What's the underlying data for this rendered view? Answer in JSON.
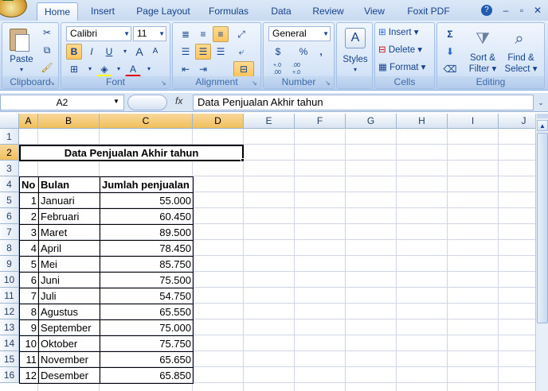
{
  "tabs": [
    "Home",
    "Insert",
    "Page Layout",
    "Formulas",
    "Data",
    "Review",
    "View",
    "Foxit PDF"
  ],
  "ribbon": {
    "clipboard": {
      "title": "Clipboard",
      "paste": "Paste"
    },
    "font": {
      "title": "Font",
      "name": "Calibri",
      "size": "11",
      "bold": "B",
      "italic": "I",
      "underline": "U",
      "grow": "A",
      "shrink": "A",
      "font_color": "A"
    },
    "alignment": {
      "title": "Alignment"
    },
    "number": {
      "title": "Number",
      "format": "General",
      "currency": "$",
      "percent": "%",
      "comma": ",",
      "inc": "+.0 .00",
      "dec": ".00 +.0"
    },
    "styles": {
      "title": "Styles",
      "label": "Styles"
    },
    "cells": {
      "title": "Cells",
      "insert": "Insert",
      "delete": "Delete",
      "format": "Format"
    },
    "editing": {
      "title": "Editing",
      "sigma": "Σ",
      "sort": "Sort &",
      "sort2": "Filter",
      "find": "Find &",
      "find2": "Select"
    }
  },
  "namebox": "A2",
  "fx": "fx",
  "formula": "Data Penjualan Akhir tahun",
  "columns": [
    "A",
    "B",
    "C",
    "D",
    "E",
    "F",
    "G",
    "H",
    "I",
    "J"
  ],
  "rows": [
    "1",
    "2",
    "3",
    "4",
    "5",
    "6",
    "7",
    "8",
    "9",
    "10",
    "11",
    "12",
    "13",
    "14",
    "15",
    "16"
  ],
  "sheet": {
    "title": "Data Penjualan Akhir tahun",
    "headers": {
      "no": "No",
      "bulan": "Bulan",
      "jumlah": "Jumlah penjualan"
    },
    "data": [
      {
        "no": "1",
        "bulan": "Januari",
        "jumlah": "55.000"
      },
      {
        "no": "2",
        "bulan": "Februari",
        "jumlah": "60.450"
      },
      {
        "no": "3",
        "bulan": "Maret",
        "jumlah": "89.500"
      },
      {
        "no": "4",
        "bulan": "April",
        "jumlah": "78.450"
      },
      {
        "no": "5",
        "bulan": "Mei",
        "jumlah": "85.750"
      },
      {
        "no": "6",
        "bulan": "Juni",
        "jumlah": "75.500"
      },
      {
        "no": "7",
        "bulan": "Juli",
        "jumlah": "54.750"
      },
      {
        "no": "8",
        "bulan": "Agustus",
        "jumlah": "65.550"
      },
      {
        "no": "9",
        "bulan": "September",
        "jumlah": "75.000"
      },
      {
        "no": "10",
        "bulan": "Oktober",
        "jumlah": "75.750"
      },
      {
        "no": "11",
        "bulan": "November",
        "jumlah": "65.650"
      },
      {
        "no": "12",
        "bulan": "Desember",
        "jumlah": "65.850"
      }
    ]
  },
  "colors": {
    "accent": "#15428b",
    "selection": "#f1c05c",
    "ribbon": "#c4d8f1"
  }
}
